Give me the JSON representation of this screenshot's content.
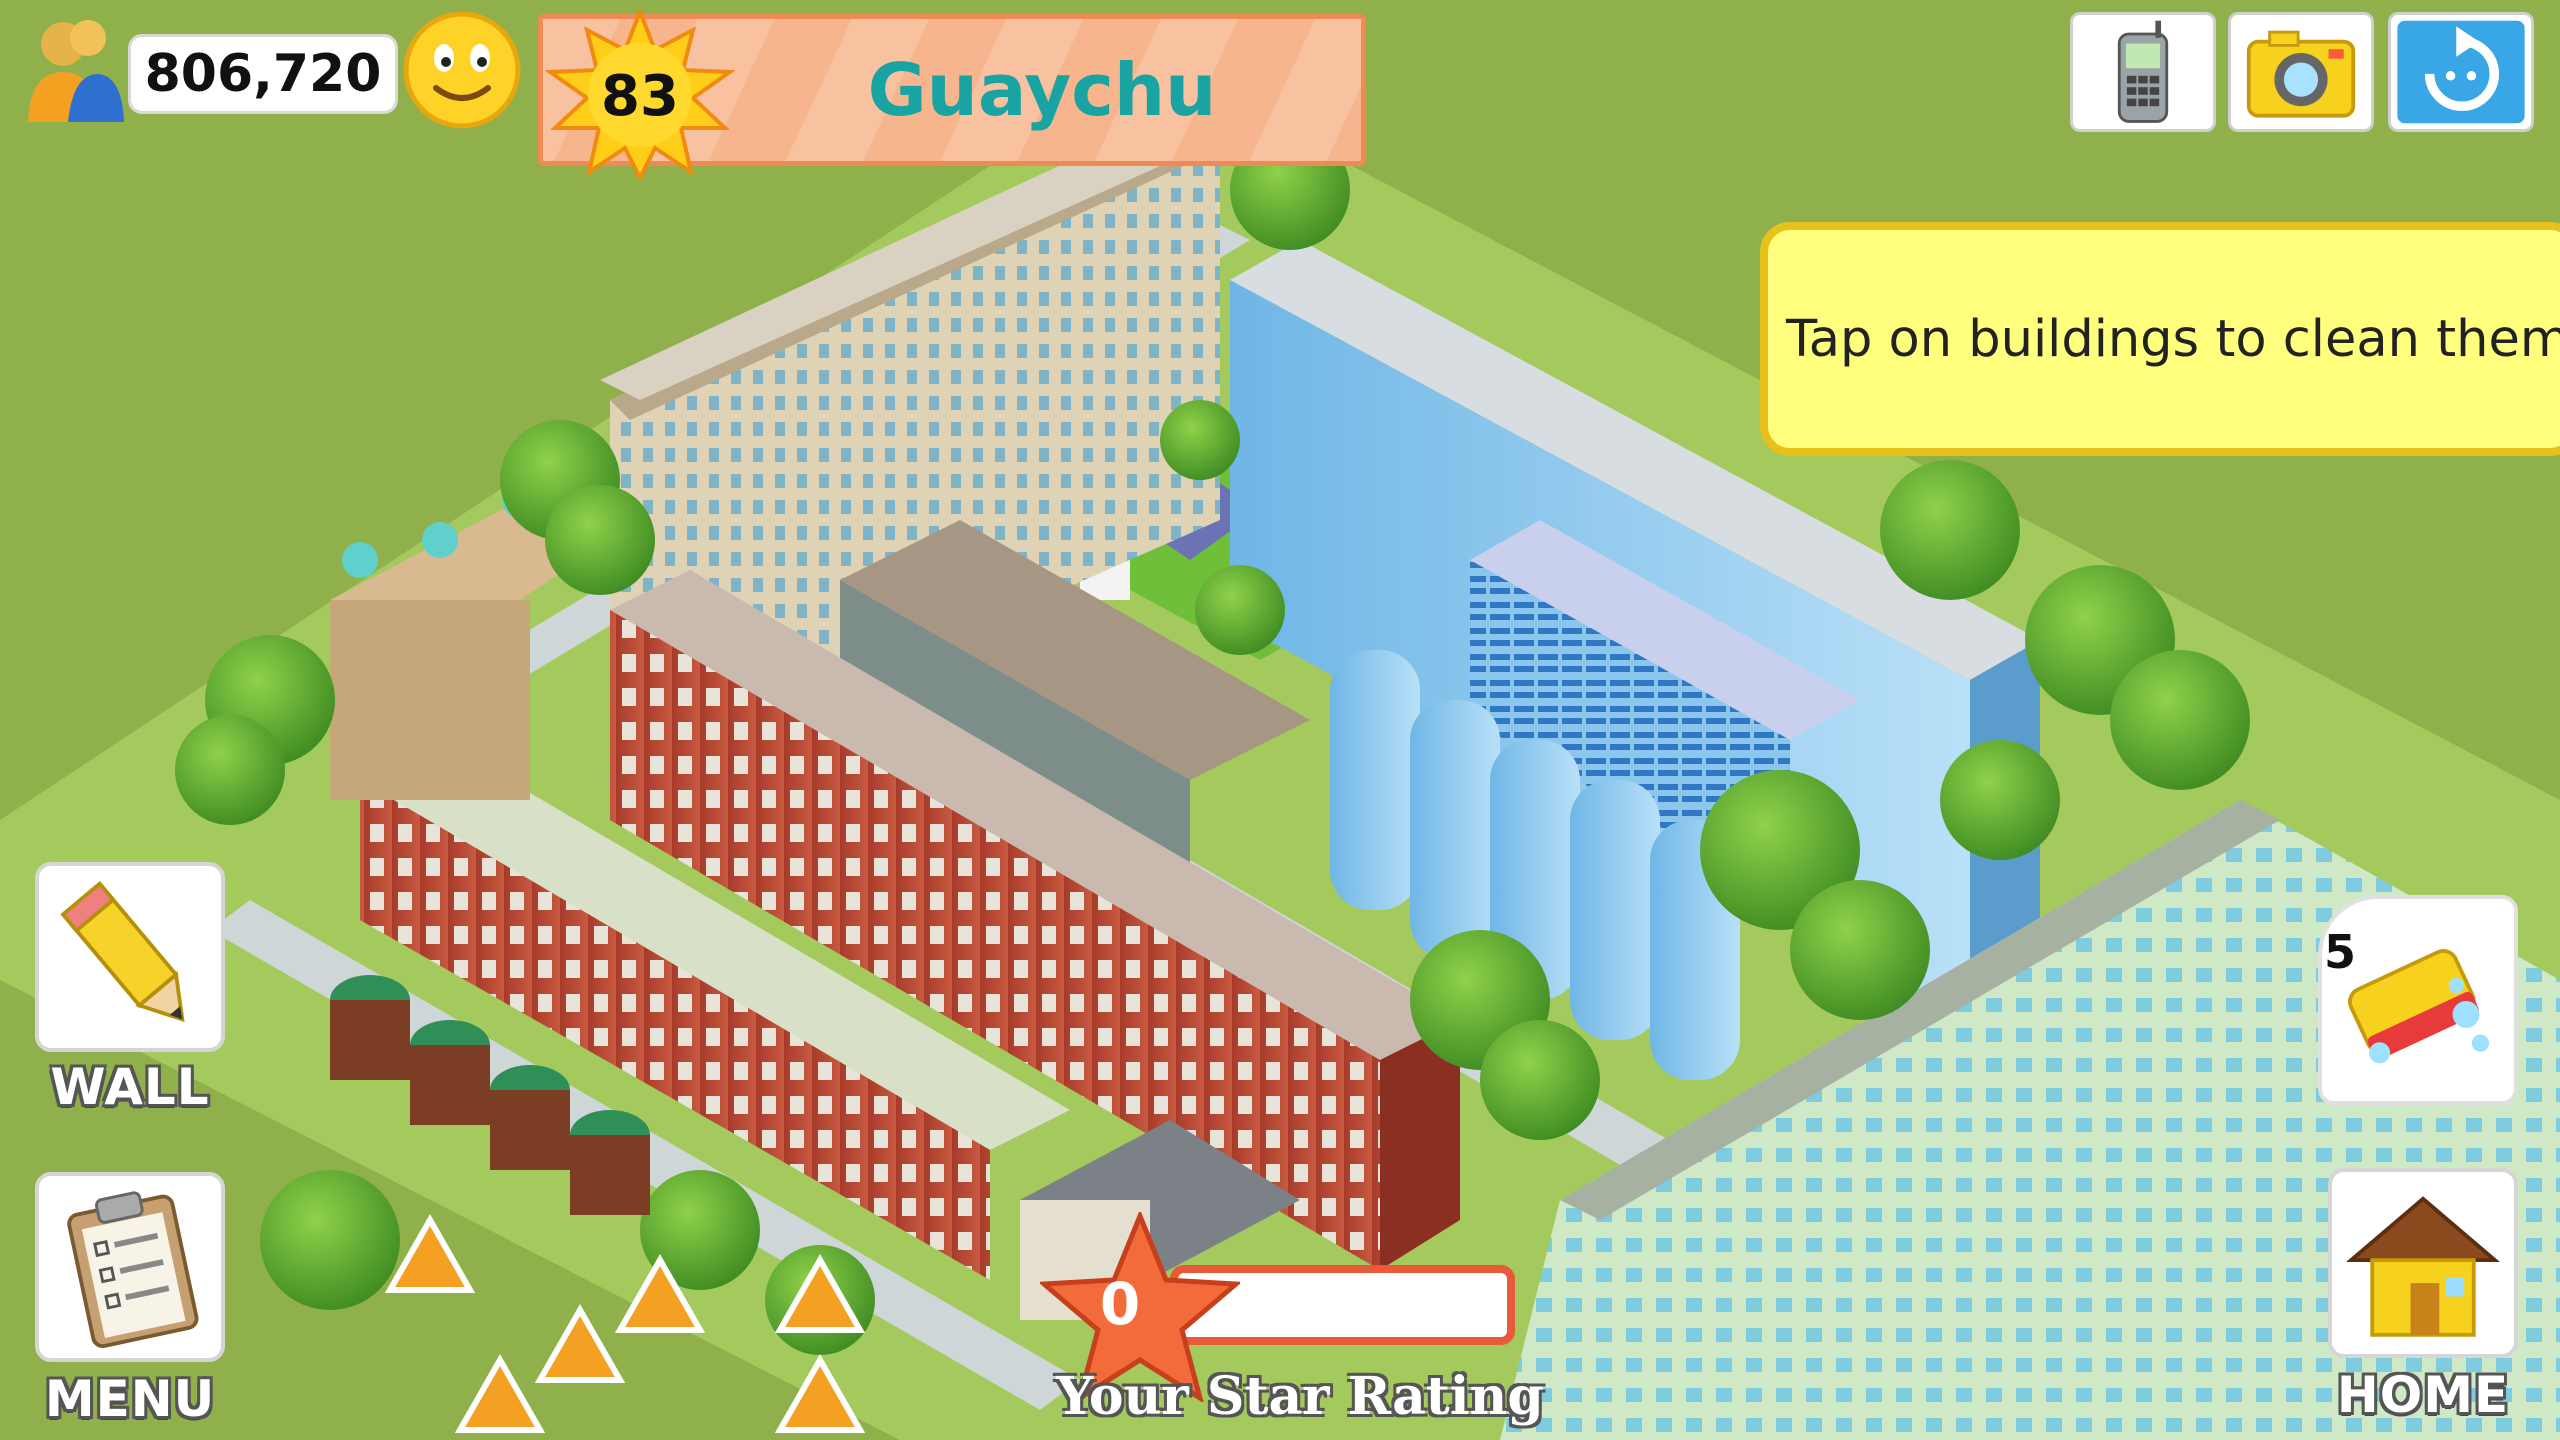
{
  "hud": {
    "coins": "806,720",
    "coins_icon": "population-people-icon",
    "mood_icon": "smiley-face-icon",
    "level": "83",
    "city_name": "Guaychu",
    "colors": {
      "banner": "#f6b58c",
      "banner_border": "#ee8a55",
      "city_name": "#1aa3a3",
      "level_sun": "#ffd21f"
    }
  },
  "top_buttons": [
    {
      "icon": "phone-icon"
    },
    {
      "icon": "camera-icon"
    },
    {
      "icon": "refresh-icon"
    }
  ],
  "tip": {
    "text": "Tap on buildings to clean them."
  },
  "left_buttons": {
    "wall_label": "WALL",
    "menu_label": "MENU"
  },
  "right_buttons": {
    "clean_count": "5",
    "home_label": "HOME"
  },
  "star_rating": {
    "value": "0",
    "label": "Your Star Rating",
    "progress": 0
  }
}
